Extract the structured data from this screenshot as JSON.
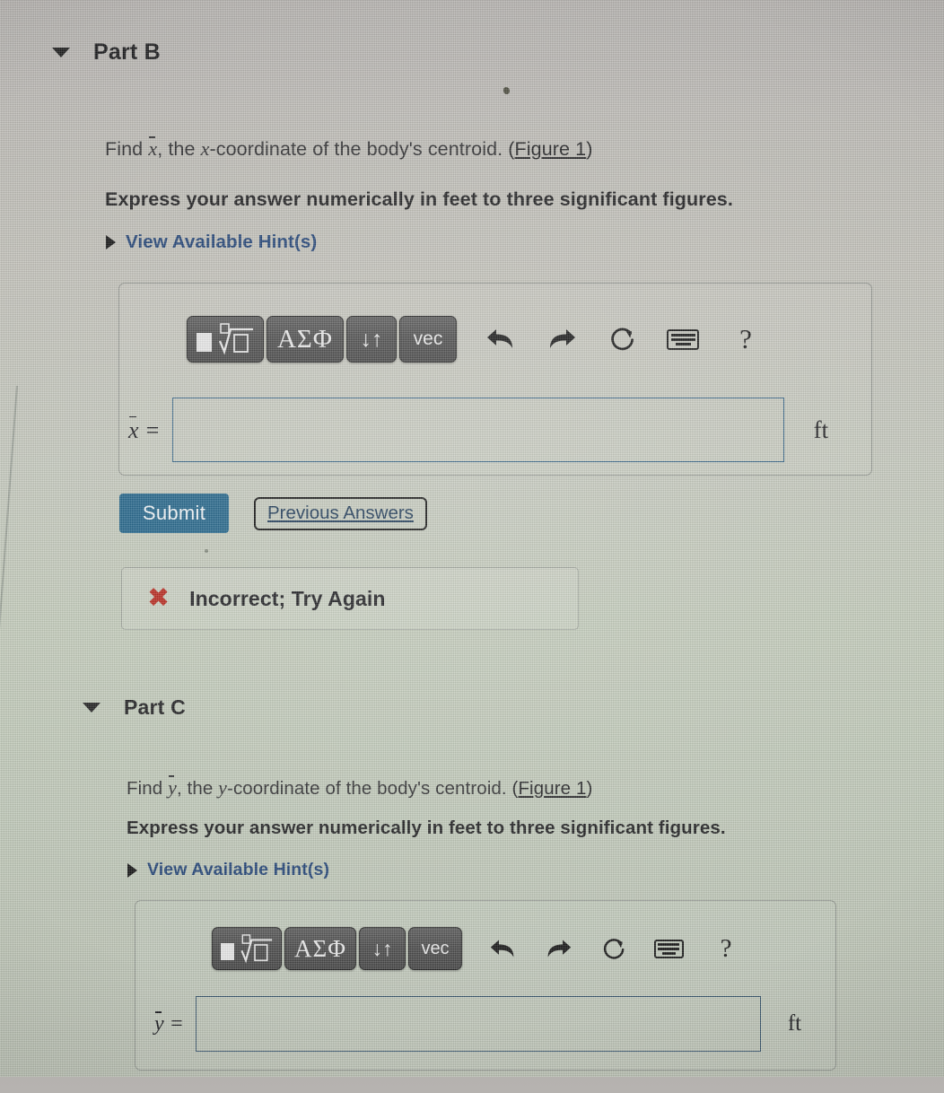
{
  "parts": [
    {
      "id": "part-b",
      "title": "Part B",
      "question_prefix": "Find ",
      "question_var": "x",
      "question_suffix_a": ", the ",
      "question_var2": "x",
      "question_suffix_b": "-coordinate of the body's centroid. ",
      "figure_link_open": "(",
      "figure_link": "Figure 1",
      "figure_link_close": ")",
      "instruction": "Express your answer numerically in feet to three significant figures.",
      "hint_label": "View Available Hint(s)",
      "toolbar": {
        "template_button": "template-math",
        "greek_button": "ΑΣΦ",
        "arrows_button": "↓↑",
        "vec_button": "vec",
        "undo": "undo",
        "redo": "redo",
        "reset": "reset",
        "keyboard": "keyboard",
        "help": "?"
      },
      "answer": {
        "label_var": "x",
        "label_eq": " =",
        "value": "",
        "placeholder": "",
        "unit": "ft"
      },
      "submit_label": "Submit",
      "previous_answers_label": "Previous Answers",
      "feedback": {
        "icon": "x-mark",
        "text": "Incorrect; Try Again"
      }
    },
    {
      "id": "part-c",
      "title": "Part C",
      "question_prefix": "Find ",
      "question_var": "y",
      "question_suffix_a": ", the ",
      "question_var2": "y",
      "question_suffix_b": "-coordinate of the body's centroid. ",
      "figure_link_open": "(",
      "figure_link": "Figure 1",
      "figure_link_close": ")",
      "instruction": "Express your answer numerically in feet to three significant figures.",
      "hint_label": "View Available Hint(s)",
      "toolbar": {
        "template_button": "template-math",
        "greek_button": "ΑΣΦ",
        "arrows_button": "↓↑",
        "vec_button": "vec",
        "undo": "undo",
        "redo": "redo",
        "reset": "reset",
        "keyboard": "keyboard",
        "help": "?"
      },
      "answer": {
        "label_var": "y",
        "label_eq": " =",
        "value": "",
        "placeholder": "",
        "unit": "ft"
      }
    }
  ],
  "colors": {
    "submit_bg": "#1e6186",
    "hint_link": "#1d3f73",
    "incorrect_red": "#b52318",
    "input_border": "#2f5f84"
  }
}
